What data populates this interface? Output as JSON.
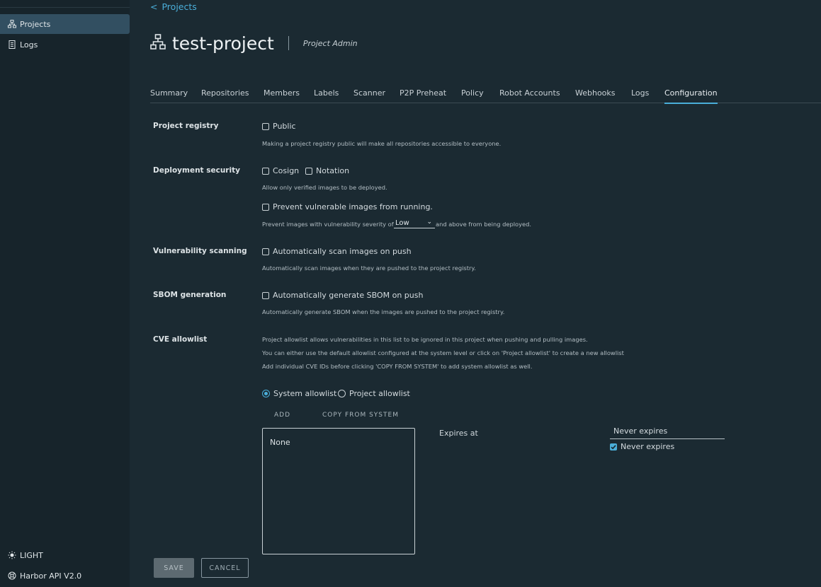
{
  "sidebar": {
    "items": [
      {
        "label": "Projects",
        "icon": "projects-icon",
        "active": true
      },
      {
        "label": "Logs",
        "icon": "logs-icon",
        "active": false
      }
    ],
    "footer": [
      {
        "label": "LIGHT",
        "icon": "sun-icon"
      },
      {
        "label": "Harbor API V2.0",
        "icon": "api-icon"
      }
    ]
  },
  "breadcrumb": {
    "arrow": "<",
    "label": "Projects"
  },
  "header": {
    "title": "test-project",
    "role": "Project Admin"
  },
  "tabs": [
    "Summary",
    "Repositories",
    "Members",
    "Labels",
    "Scanner",
    "P2P Preheat",
    "Policy",
    "Robot Accounts",
    "Webhooks",
    "Logs",
    "Configuration"
  ],
  "active_tab": "Configuration",
  "config": {
    "registry": {
      "label": "Project registry",
      "public_label": "Public",
      "public_checked": false,
      "help": "Making a project registry public will make all repositories accessible to everyone."
    },
    "deployment": {
      "label": "Deployment security",
      "cosign_label": "Cosign",
      "notation_label": "Notation",
      "help": "Allow only verified images to be deployed.",
      "prevent_label": "Prevent vulnerable images from running.",
      "prevent_help_before": "Prevent images with vulnerability severity of",
      "severity": "Low",
      "prevent_help_after": "and above from being deployed."
    },
    "scanning": {
      "label": "Vulnerability scanning",
      "option_label": "Automatically scan images on push",
      "help": "Automatically scan images when they are pushed to the project registry."
    },
    "sbom": {
      "label": "SBOM generation",
      "option_label": "Automatically generate SBOM on push",
      "help": "Automatically generate SBOM when the images are pushed to the project registry."
    },
    "cve": {
      "label": "CVE allowlist",
      "help1": "Project allowlist allows vulnerabilities in this list to be ignored in this project when pushing and pulling images.",
      "help2": "You can either use the default allowlist configured at the system level or click on 'Project allowlist' to create a new allowlist",
      "help3": "Add individual CVE IDs before clicking 'COPY FROM SYSTEM' to add system allowlist as well.",
      "system_radio": "System allowlist",
      "project_radio": "Project allowlist",
      "selected": "system",
      "add_label": "ADD",
      "copy_label": "COPY FROM SYSTEM",
      "list_value": "None",
      "expires_label": "Expires at",
      "expires_value": "Never expires",
      "never_expires_label": "Never expires",
      "never_expires_checked": true
    }
  },
  "actions": {
    "save": "SAVE",
    "cancel": "CANCEL"
  }
}
